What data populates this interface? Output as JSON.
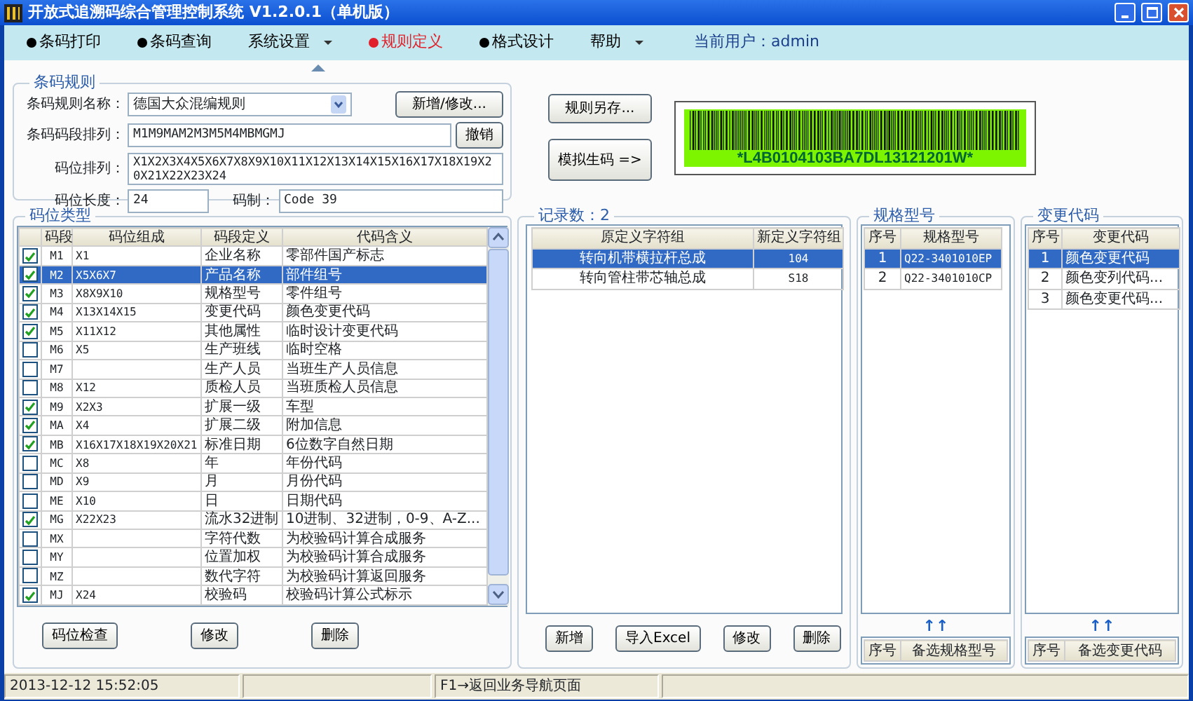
{
  "window": {
    "title": "开放式追溯码综合管理控制系统 V1.2.0.1（单机版）"
  },
  "menu": [
    {
      "label": "条码打印",
      "kind": "dot",
      "selected": false
    },
    {
      "label": "条码查询",
      "kind": "dot",
      "selected": false
    },
    {
      "label": "系统设置",
      "kind": "dropdown",
      "selected": false
    },
    {
      "label": "规则定义",
      "kind": "dot",
      "selected": true
    },
    {
      "label": "格式设计",
      "kind": "dot",
      "selected": false
    },
    {
      "label": "帮助",
      "kind": "dropdown",
      "selected": false
    }
  ],
  "current_user": "当前用户：admin",
  "barcode_rule": {
    "title": "条码规则",
    "name_label": "条码规则名称：",
    "name_value": "德国大众混编规则",
    "add_button": "新增/修改...",
    "segment_label": "条码码段排列：",
    "segment_value": "M1M9MAM2M3M5M4MBMGMJ",
    "cancel_button": "撤销",
    "position_label": "码位排列：",
    "position_value": "X1X2X3X4X5X6X7X8X9X10X11X12X13X14X15X16X17X18X19X20X21X22X23X24",
    "length_label": "码位长度：",
    "length_value": "24",
    "type_label": "码制：",
    "type_value": "Code 39"
  },
  "save_as_button": "规则另存...",
  "simulate_button": "模拟生码 =>",
  "barcode": {
    "text": "*L4B0104103BA7DL13121201W*"
  },
  "position_types": {
    "title": "码位类型",
    "columns": [
      "码段",
      "码位组成",
      "码段定义",
      "代码含义"
    ],
    "rows": [
      {
        "checked": true,
        "selected": false,
        "segment": "M1",
        "composition": "X1",
        "definition": "企业名称",
        "meaning": "零部件国产标志"
      },
      {
        "checked": true,
        "selected": true,
        "segment": "M2",
        "composition": "X5X6X7",
        "definition": "产品名称",
        "meaning": "部件组号"
      },
      {
        "checked": true,
        "selected": false,
        "segment": "M3",
        "composition": "X8X9X10",
        "definition": "规格型号",
        "meaning": "零件组号"
      },
      {
        "checked": true,
        "selected": false,
        "segment": "M4",
        "composition": "X13X14X15",
        "definition": "变更代码",
        "meaning": "颜色变更代码"
      },
      {
        "checked": true,
        "selected": false,
        "segment": "M5",
        "composition": "X11X12",
        "definition": "其他属性",
        "meaning": "临时设计变更代码"
      },
      {
        "checked": false,
        "selected": false,
        "segment": "M6",
        "composition": "X5",
        "definition": "生产班线",
        "meaning": "临时空格"
      },
      {
        "checked": false,
        "selected": false,
        "segment": "M7",
        "definition": "生产人员",
        "meaning": "当班生产人员信息"
      },
      {
        "checked": false,
        "selected": false,
        "segment": "M8",
        "composition": "X12",
        "definition": "质检人员",
        "meaning": "当班质检人员信息"
      },
      {
        "checked": true,
        "selected": false,
        "segment": "M9",
        "composition": "X2X3",
        "definition": "扩展一级",
        "meaning": "车型"
      },
      {
        "checked": true,
        "selected": false,
        "segment": "MA",
        "composition": "X4",
        "definition": "扩展二级",
        "meaning": "附加信息"
      },
      {
        "checked": true,
        "selected": false,
        "segment": "MB",
        "composition": "X16X17X18X19X20X21",
        "definition": "标准日期",
        "meaning": "6位数字自然日期"
      },
      {
        "checked": false,
        "selected": false,
        "segment": "MC",
        "composition": "X8",
        "definition": "年",
        "meaning": "年份代码"
      },
      {
        "checked": false,
        "selected": false,
        "segment": "MD",
        "composition": "X9",
        "definition": "月",
        "meaning": "月份代码"
      },
      {
        "checked": false,
        "selected": false,
        "segment": "ME",
        "composition": "X10",
        "definition": "日",
        "meaning": "日期代码"
      },
      {
        "checked": true,
        "selected": false,
        "segment": "MG",
        "composition": "X22X23",
        "definition": "流水32进制",
        "meaning": "10进制、32进制，0-9、A-Z..."
      },
      {
        "checked": false,
        "selected": false,
        "segment": "MX",
        "definition": "字符代数",
        "meaning": "为校验码计算合成服务"
      },
      {
        "checked": false,
        "selected": false,
        "segment": "MY",
        "definition": "位置加权",
        "meaning": "为校验码计算合成服务"
      },
      {
        "checked": false,
        "selected": false,
        "segment": "MZ",
        "definition": "数代字符",
        "meaning": "为校验码计算返回服务"
      },
      {
        "checked": true,
        "selected": false,
        "segment": "MJ",
        "composition": "X24",
        "definition": "校验码",
        "meaning": "校验码计算公式标示"
      }
    ],
    "buttons": [
      "码位检查",
      "修改",
      "删除"
    ]
  },
  "records": {
    "title": "记录数：2",
    "columns": [
      "原定义字符组",
      "新定义字符组"
    ],
    "rows": [
      {
        "selected": true,
        "cells": [
          "转向机带横拉杆总成",
          "104"
        ]
      },
      {
        "selected": false,
        "cells": [
          "转向管柱带芯轴总成",
          "S18"
        ]
      }
    ],
    "buttons": [
      "新增",
      "导入Excel",
      "修改",
      "删除"
    ]
  },
  "spec_models": {
    "title": "规格型号",
    "columns": [
      "序号",
      "规格型号"
    ],
    "rows": [
      {
        "selected": true,
        "cells": [
          "1",
          "Q22-3401010EP"
        ]
      },
      {
        "selected": false,
        "cells": [
          "2",
          "Q22-3401010CP"
        ]
      }
    ],
    "arrows": "↑↑",
    "footer_columns": [
      "序号",
      "备选规格型号"
    ]
  },
  "change_codes": {
    "title": "变更代码",
    "columns": [
      "序号",
      "变更代码"
    ],
    "rows": [
      {
        "selected": true,
        "cells": [
          "1",
          "颜色变更代码"
        ]
      },
      {
        "selected": false,
        "cells": [
          "2",
          "颜色变列代码..."
        ]
      },
      {
        "selected": false,
        "cells": [
          "3",
          "颜色变更代码..."
        ]
      }
    ],
    "arrows": "↑↑",
    "footer_columns": [
      "序号",
      "备选变更代码"
    ]
  },
  "status_bar": [
    "2013-12-12 15:52:05",
    "F1→返回业务导航页面"
  ]
}
